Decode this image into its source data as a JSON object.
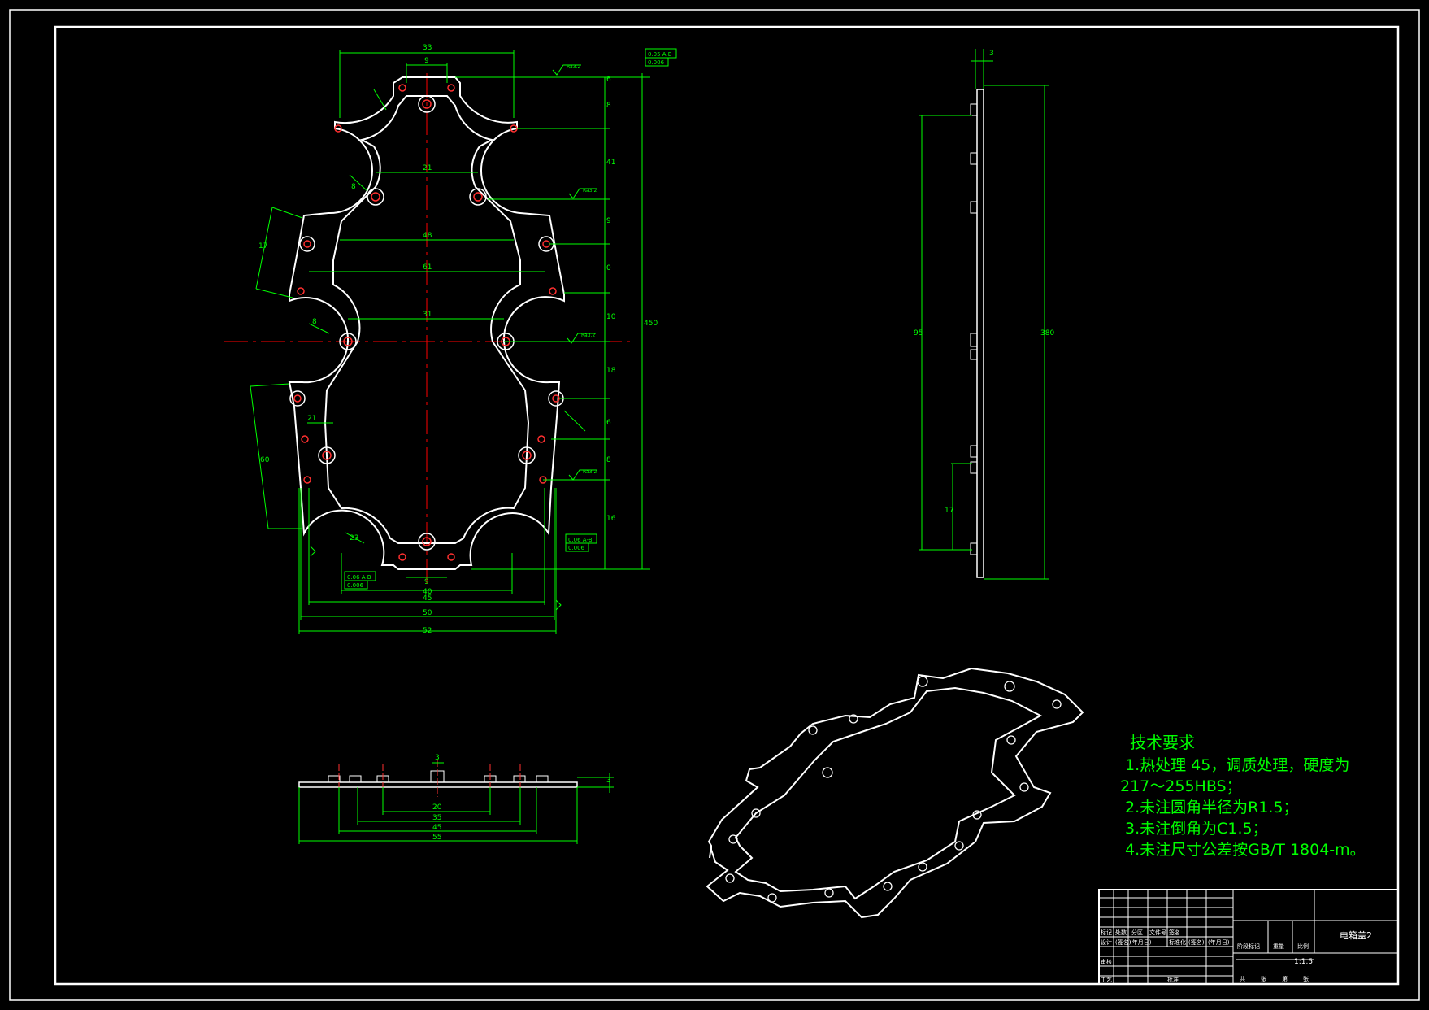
{
  "drawing": {
    "title": "电箱盖2",
    "scale": "1:1.5",
    "colors": {
      "background": "#000000",
      "frame": "#ffffff",
      "dimension": "#00ff00",
      "centerline": "#ff0000",
      "hole": "#ff3030"
    }
  },
  "tech_requirements": {
    "heading": "技术要求",
    "items": [
      "1.热处理 45，调质处理，硬度为",
      "217～255HBS；",
      "2.未注圆角半径为R1.5；",
      "3.未注倒角为C1.5；",
      "4.未注尺寸公差按GB/T 1804-m。"
    ]
  },
  "front_view": {
    "dims_top": [
      "33",
      "9"
    ],
    "dims_inner": [
      "21",
      "48",
      "61",
      "31",
      "21"
    ],
    "dims_bottom": [
      "9",
      "40",
      "45",
      "50",
      "52"
    ],
    "dims_right": [
      "6",
      "8",
      "41",
      "9",
      "0",
      "10",
      "18",
      "6",
      "8",
      "16",
      "450"
    ],
    "dims_left": [
      "17",
      "8",
      "8",
      "60",
      "23"
    ],
    "tolerance_frames": [
      "0.05 A-B",
      "0.006",
      "0.06 A-B",
      "0.006",
      "0.06 A-B",
      "0.006"
    ],
    "roughness": [
      "Ra3.2",
      "Ra3.2",
      "Ra3.2",
      "Ra3.2",
      "Ra3.2",
      "Ra3.2",
      "Ra3.2"
    ]
  },
  "side_view": {
    "dims": [
      "3",
      "95",
      "380",
      "17"
    ]
  },
  "bottom_view": {
    "dims": [
      "3",
      "3",
      "20",
      "35",
      "45",
      "55"
    ]
  },
  "title_block": {
    "cells": [
      "标记",
      "处数",
      "分区",
      "文件号",
      "签名",
      "设计",
      "(签名)",
      "(年月日)",
      "标准化",
      "(签名)",
      "(年月日)",
      "阶段标记",
      "重量",
      "比例",
      "审核",
      "工艺",
      "批准",
      "共",
      "张",
      "第",
      "张"
    ]
  }
}
